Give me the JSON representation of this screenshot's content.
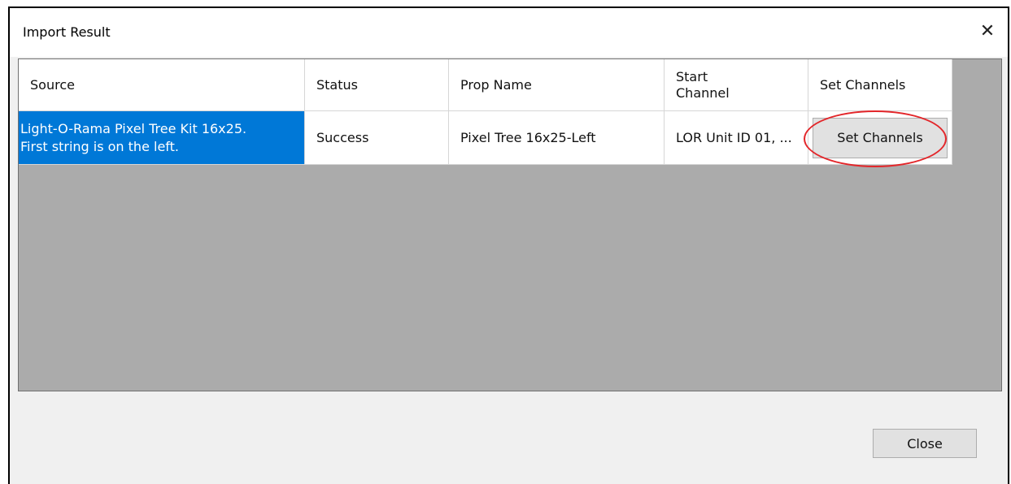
{
  "window": {
    "title": "Import Result",
    "close_glyph": "✕"
  },
  "grid": {
    "columns": [
      {
        "label": "Source"
      },
      {
        "label": "Status"
      },
      {
        "label": "Prop Name"
      },
      {
        "label_line1": "Start",
        "label_line2": "Channel"
      },
      {
        "label": "Set Channels"
      }
    ],
    "rows": [
      {
        "source_line1": "Light-O-Rama Pixel Tree Kit 16x25.",
        "source_line2": "First string is on the left.",
        "status": "Success",
        "prop_name": "Pixel Tree 16x25-Left",
        "start_channel": "LOR Unit ID 01, ...",
        "set_channels_button": "Set Channels"
      }
    ]
  },
  "footer": {
    "close_label": "Close"
  },
  "colors": {
    "selection": "#0078d7",
    "grid_empty": "#ababab",
    "highlight_ring": "#e3262a"
  }
}
